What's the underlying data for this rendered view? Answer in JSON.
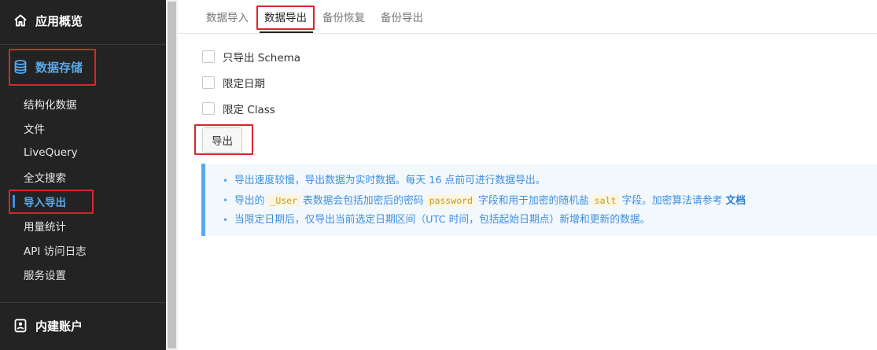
{
  "sidebar": {
    "overview": {
      "label": "应用概览",
      "icon": "home-icon"
    },
    "storage": {
      "label": "数据存储",
      "icon": "database-icon"
    },
    "items": [
      {
        "label": "结构化数据"
      },
      {
        "label": "文件"
      },
      {
        "label": "LiveQuery"
      },
      {
        "label": "全文搜索"
      },
      {
        "label": "导入导出",
        "active": true
      },
      {
        "label": "用量统计"
      },
      {
        "label": "API 访问日志"
      },
      {
        "label": "服务设置"
      }
    ],
    "account": {
      "label": "内建账户",
      "icon": "account-icon"
    }
  },
  "tabs": [
    {
      "label": "数据导入"
    },
    {
      "label": "数据导出",
      "active": true
    },
    {
      "label": "备份恢复"
    },
    {
      "label": "备份导出"
    }
  ],
  "options": [
    {
      "label": "只导出 Schema",
      "checked": false
    },
    {
      "label": "限定日期",
      "checked": false
    },
    {
      "label": "限定 Class",
      "checked": false
    }
  ],
  "export_button": {
    "label": "导出"
  },
  "notes": {
    "line1": "导出速度较慢，导出数据为实时数据。每天 16 点前可进行数据导出。",
    "line2": {
      "t1": "导出的",
      "code1": "_User",
      "t2": "表数据会包括加密后的密码",
      "code2": "password",
      "t3": "字段和用于加密的随机盐",
      "code3": "salt",
      "t4": "字段。加密算法请参考",
      "link": "文档"
    },
    "line3": "当限定日期后，仅导出当前选定日期区间（UTC 时间，包括起始日期点）新增和更新的数据。"
  },
  "colors": {
    "sidebar_bg": "#232323",
    "accent": "#5aa9ec",
    "highlight_box": "#d9262b",
    "note_bg": "#f3f8fd"
  }
}
